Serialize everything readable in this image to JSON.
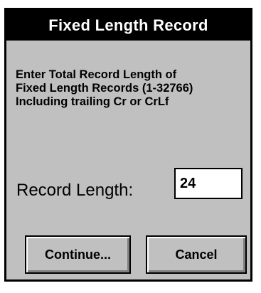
{
  "dialog": {
    "title": "Fixed Length Record",
    "instructions": [
      "Enter Total Record Length of",
      "Fixed Length Records (1-32766)",
      "Including trailing Cr or CrLf"
    ],
    "record_length_label": "Record Length:",
    "record_length_value": "24",
    "continue_label": "Continue...",
    "cancel_label": "Cancel"
  },
  "colors": {
    "dialog_background": "#c0c0c0",
    "titlebar_background": "#000000",
    "titlebar_text": "#ffffff",
    "input_background": "#ffffff"
  }
}
